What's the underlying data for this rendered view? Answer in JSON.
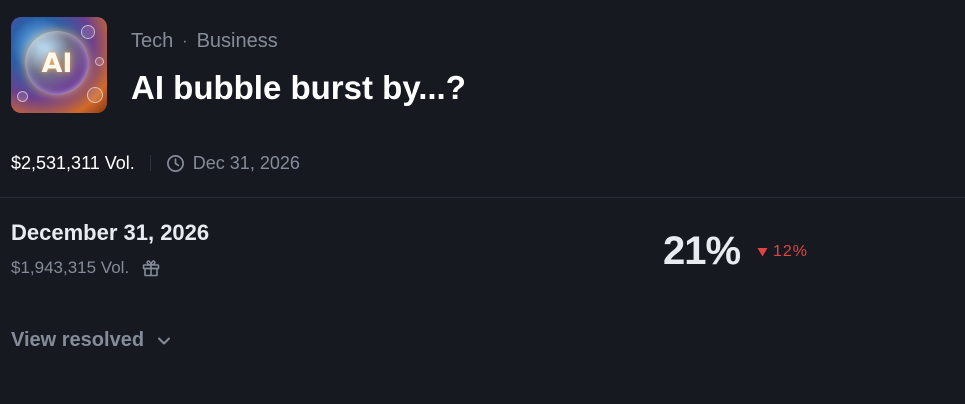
{
  "market": {
    "thumbnail_text": "AI",
    "categories": [
      "Tech",
      "Business"
    ],
    "separator": "·",
    "title": "AI bubble burst by...?",
    "volume": "$2,531,311 Vol.",
    "end_date": "Dec 31, 2026"
  },
  "outcome": {
    "name": "December 31, 2026",
    "volume": "$1,943,315 Vol.",
    "probability": "21%",
    "change": "12%",
    "change_direction": "down"
  },
  "footer": {
    "view_resolved_label": "View resolved"
  },
  "icons": {
    "clock": "clock-icon",
    "gift": "gift-icon",
    "triangle": "triangle-down-icon",
    "chevron": "chevron-down-icon"
  },
  "colors": {
    "background": "#16191f",
    "muted": "#858c99",
    "negative": "#e04545"
  }
}
